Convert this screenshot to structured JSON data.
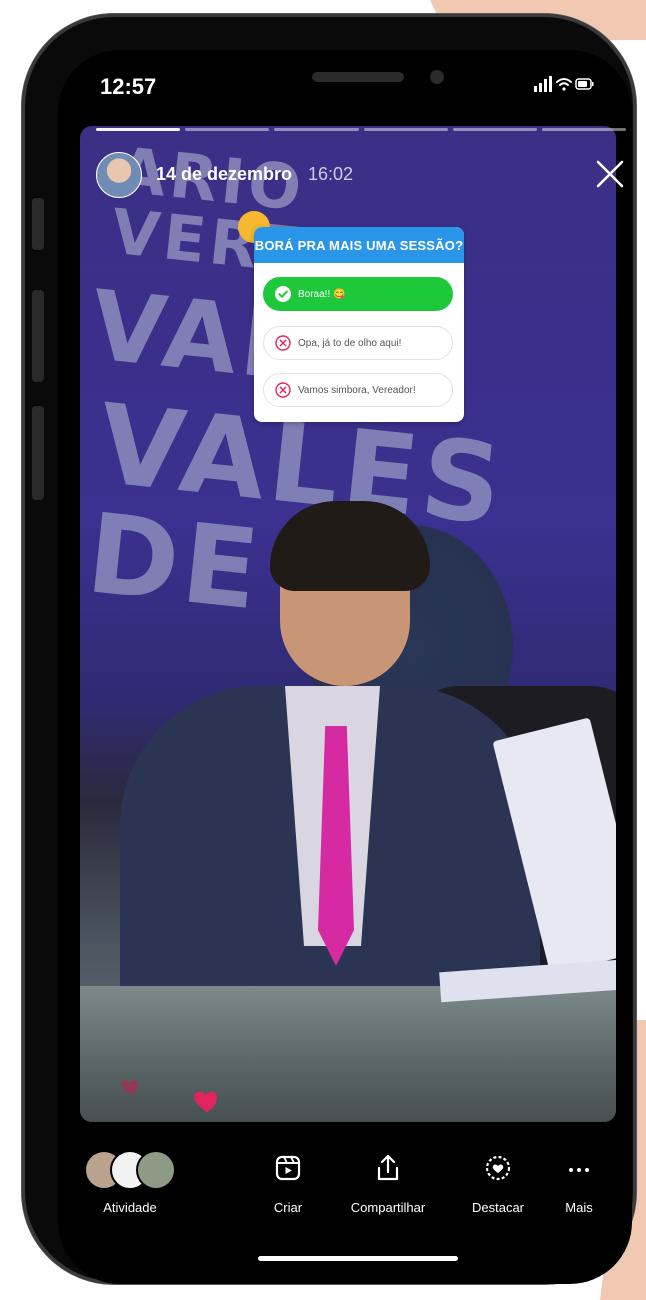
{
  "status_bar": {
    "time": "12:57"
  },
  "story": {
    "date": "14 de dezembro",
    "time": "16:02",
    "segments": [
      1,
      0,
      0,
      0,
      0,
      0
    ]
  },
  "poll": {
    "question": "BORÁ PRA MAIS UMA SESSÃO?",
    "options": [
      {
        "label": "Boraa!! 😋",
        "selected": true
      },
      {
        "label": "Opa, já to de olho aqui!",
        "selected": false
      },
      {
        "label": "Vamos simbora, Vereador!",
        "selected": false
      }
    ]
  },
  "bottom_bar": {
    "activity_label": "Atividade",
    "create_label": "Criar",
    "share_label": "Compartilhar",
    "highlight_label": "Destacar",
    "more_label": "Mais"
  },
  "colors": {
    "poll_header": "#2a96ea",
    "poll_selected": "#1dc93b",
    "sticker_dot": "#f5b82e",
    "heart": "#e0245e"
  }
}
